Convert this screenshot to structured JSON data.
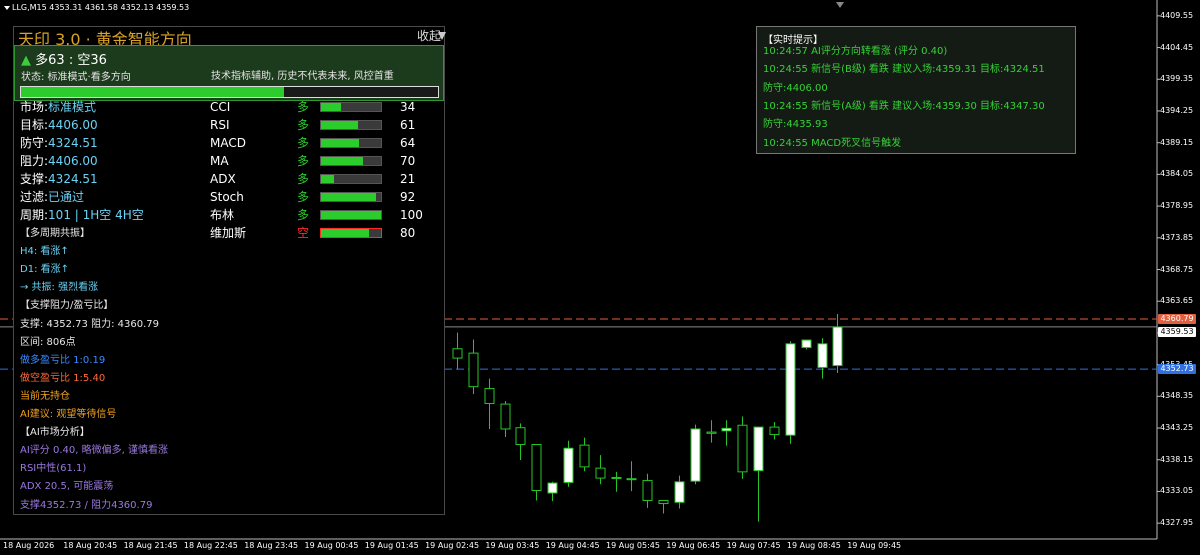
{
  "window": {
    "symbol_header": "LLG,M15  4353.31 4361.58 4352.13 4359.53"
  },
  "colors": {
    "bull_candle": "#ffffff",
    "bear_candle": "#000000",
    "wick": "#27c427",
    "resistance_line": "#e06040",
    "support_line": "#3070e0",
    "current_price_line": "#8a8a8a",
    "panel_accent": "#2ccc2c",
    "title_gold": "#d8a326"
  },
  "y_axis": {
    "ticks": [
      "4409.55",
      "4404.45",
      "4399.35",
      "4394.25",
      "4389.15",
      "4384.05",
      "4378.95",
      "4373.85",
      "4368.75",
      "4363.65",
      "4358.55",
      "4353.45",
      "4348.35",
      "4343.25",
      "4338.15",
      "4333.05",
      "4327.95"
    ],
    "price_tags": [
      {
        "label": "4360.79",
        "color": "#e06040",
        "price": 4360.79
      },
      {
        "label": "4359.53",
        "color": "#ffffff",
        "price": 4359.53,
        "text_color": "#000000"
      },
      {
        "label": "4352.73",
        "color": "#3070e0",
        "price": 4352.73
      }
    ]
  },
  "x_axis": {
    "ticks": [
      "18 Aug 2026",
      "18 Aug 20:45",
      "18 Aug 21:45",
      "18 Aug 22:45",
      "18 Aug 23:45",
      "19 Aug 00:45",
      "19 Aug 01:45",
      "19 Aug 02:45",
      "19 Aug 03:45",
      "19 Aug 04:45",
      "19 Aug 05:45",
      "19 Aug 06:45",
      "19 Aug 07:45",
      "19 Aug 08:45",
      "19 Aug 09:45"
    ]
  },
  "chart_data": {
    "type": "candlestick",
    "ylim": [
      4325.4,
      4412.1
    ],
    "lines": {
      "resistance": 4360.79,
      "support": 4352.73,
      "current": 4359.53
    },
    "candles": [
      {
        "o": 4356.0,
        "h": 4358.6,
        "l": 4352.7,
        "c": 4354.5
      },
      {
        "o": 4355.3,
        "h": 4357.5,
        "l": 4348.7,
        "c": 4349.9
      },
      {
        "o": 4349.6,
        "h": 4351.2,
        "l": 4343.1,
        "c": 4347.2
      },
      {
        "o": 4347.1,
        "h": 4347.6,
        "l": 4341.8,
        "c": 4343.1
      },
      {
        "o": 4343.3,
        "h": 4344.0,
        "l": 4338.1,
        "c": 4340.6
      },
      {
        "o": 4340.6,
        "h": 4340.6,
        "l": 4331.6,
        "c": 4333.2
      },
      {
        "o": 4332.8,
        "h": 4334.6,
        "l": 4331.5,
        "c": 4334.4
      },
      {
        "o": 4334.5,
        "h": 4341.2,
        "l": 4333.8,
        "c": 4340.0
      },
      {
        "o": 4340.5,
        "h": 4341.7,
        "l": 4336.3,
        "c": 4337.0
      },
      {
        "o": 4336.8,
        "h": 4338.9,
        "l": 4334.2,
        "c": 4335.2
      },
      {
        "o": 4335.3,
        "h": 4336.2,
        "l": 4333.0,
        "c": 4335.2
      },
      {
        "o": 4335.1,
        "h": 4337.9,
        "l": 4333.1,
        "c": 4335.1
      },
      {
        "o": 4334.8,
        "h": 4335.9,
        "l": 4330.4,
        "c": 4331.6
      },
      {
        "o": 4331.6,
        "h": 4331.6,
        "l": 4329.5,
        "c": 4331.1
      },
      {
        "o": 4331.3,
        "h": 4335.6,
        "l": 4330.3,
        "c": 4334.6
      },
      {
        "o": 4334.7,
        "h": 4343.8,
        "l": 4334.2,
        "c": 4343.1
      },
      {
        "o": 4342.6,
        "h": 4344.5,
        "l": 4340.9,
        "c": 4342.4
      },
      {
        "o": 4342.8,
        "h": 4344.5,
        "l": 4340.4,
        "c": 4343.2
      },
      {
        "o": 4343.7,
        "h": 4345.1,
        "l": 4335.1,
        "c": 4336.2
      },
      {
        "o": 4336.4,
        "h": 4341.5,
        "l": 4328.2,
        "c": 4343.4
      },
      {
        "o": 4343.4,
        "h": 4344.2,
        "l": 4341.4,
        "c": 4342.2
      },
      {
        "o": 4342.1,
        "h": 4357.2,
        "l": 4340.7,
        "c": 4356.8
      },
      {
        "o": 4356.2,
        "h": 4357.2,
        "l": 4355.9,
        "c": 4357.4
      },
      {
        "o": 4353.0,
        "h": 4357.7,
        "l": 4351.2,
        "c": 4356.8
      },
      {
        "o": 4353.3,
        "h": 4361.6,
        "l": 4352.1,
        "c": 4359.5
      }
    ]
  },
  "panel": {
    "title": "天印 3.0 · 黄金智能方向",
    "fold_label": "收起",
    "status_box": {
      "arrow": "▲",
      "ratio_text": "多63 : 空36",
      "status_text": "状态: 标准模式·看多方向",
      "disclaimer": "技术指标辅助, 历史不代表未来, 风控首重",
      "bull_fraction": 0.63
    },
    "info_rows": [
      {
        "key": "市场:",
        "value": "标准模式"
      },
      {
        "key": "目标:",
        "value": "4406.00"
      },
      {
        "key": "防守:",
        "value": "4324.51"
      },
      {
        "key": "阻力:",
        "value": "4406.00"
      },
      {
        "key": "支撑:",
        "value": "4324.51"
      },
      {
        "key": "过滤:",
        "value": "已通过"
      },
      {
        "key": "周期:",
        "value": "101 | 1H空 4H空"
      }
    ],
    "indicators": [
      {
        "name": "CCI",
        "dir": "多",
        "dir_color": "#2ccc2c",
        "score": 34,
        "bar_color": "#2ccc2c"
      },
      {
        "name": "RSI",
        "dir": "多",
        "dir_color": "#2ccc2c",
        "score": 61,
        "bar_color": "#2ccc2c"
      },
      {
        "name": "MACD",
        "dir": "多",
        "dir_color": "#2ccc2c",
        "score": 64,
        "bar_color": "#2ccc2c"
      },
      {
        "name": "MA",
        "dir": "多",
        "dir_color": "#2ccc2c",
        "score": 70,
        "bar_color": "#2ccc2c"
      },
      {
        "name": "ADX",
        "dir": "多",
        "dir_color": "#2ccc2c",
        "score": 21,
        "bar_color": "#2ccc2c"
      },
      {
        "name": "Stoch",
        "dir": "多",
        "dir_color": "#2ccc2c",
        "score": 92,
        "bar_color": "#2ccc2c"
      },
      {
        "name": "布林",
        "dir": "多",
        "dir_color": "#2ccc2c",
        "score": 100,
        "bar_color": "#2ccc2c"
      },
      {
        "name": "维加斯",
        "dir": "空",
        "dir_color": "#ff2a2a",
        "score": 80,
        "bar_color": "#2ccc2c",
        "bar_border": "#ff2a2a"
      }
    ],
    "sections": [
      {
        "text": "【多周期共振】",
        "color": "#e8e8e8"
      },
      {
        "text": "H4: 看涨↑",
        "color": "#6ad2f4"
      },
      {
        "text": "D1: 看涨↑",
        "color": "#6ad2f4"
      },
      {
        "text": "→ 共振: 强烈看涨",
        "color": "#6ad2f4"
      },
      {
        "text": "【支撑阻力/盈亏比】",
        "color": "#e8e8e8"
      },
      {
        "text": "支撑: 4352.73 阻力: 4360.79",
        "color": "#e8e8e8"
      },
      {
        "text": "区间: 806点",
        "color": "#e8e8e8"
      },
      {
        "text": "做多盈亏比 1:0.19",
        "color": "#3a8cff"
      },
      {
        "text": "做空盈亏比 1:5.40",
        "color": "#ff6a3a"
      },
      {
        "text": "当前无持仓",
        "color": "#f0a020"
      },
      {
        "text": "AI建议: 观望等待信号",
        "color": "#f0a020"
      },
      {
        "text": "【AI市场分析】",
        "color": "#e8e8e8"
      },
      {
        "text": "AI评分 0.40, 略微偏多, 谨慎看涨",
        "color": "#9a78e0"
      },
      {
        "text": "RSI中性(61.1)",
        "color": "#9a78e0"
      },
      {
        "text": "ADX 20.5, 可能震荡",
        "color": "#9a78e0"
      },
      {
        "text": "支撑4352.73 / 阻力4360.79",
        "color": "#9a78e0"
      }
    ]
  },
  "alerts": {
    "title": "【实时提示】",
    "lines": [
      "10:24:57 AI评分方向转看涨 (评分 0.40)",
      "10:24:55 新信号(B级) 看跌 建议入场:4359.31 目标:4324.51",
      "防守:4406.00",
      "10:24:55 新信号(A级) 看跌 建议入场:4359.30 目标:4347.30",
      "防守:4435.93",
      "10:24:55 MACD死叉信号触发"
    ]
  }
}
